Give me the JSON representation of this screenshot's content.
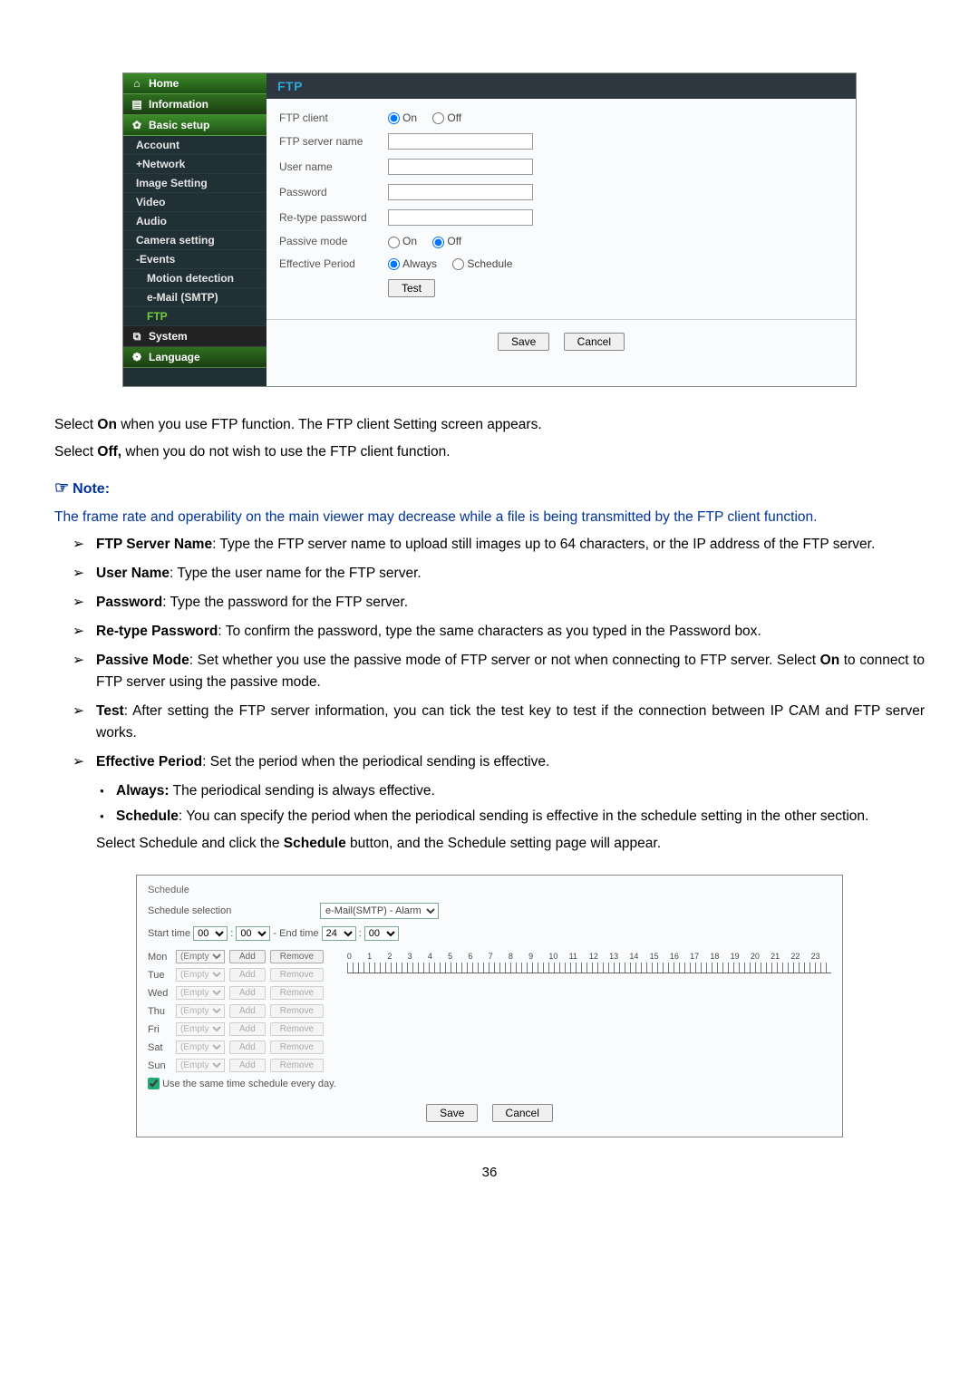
{
  "sidebar": {
    "home": "Home",
    "information": "Information",
    "basic_setup": "Basic setup",
    "account": "Account",
    "network": "+Network",
    "image_setting": "Image Setting",
    "video": "Video",
    "audio": "Audio",
    "camera_setting": "Camera setting",
    "events": "-Events",
    "motion_detection": "Motion detection",
    "email_smtp": "e-Mail (SMTP)",
    "ftp": "FTP",
    "system": "System",
    "language": "Language"
  },
  "ftp": {
    "title": "FTP",
    "client_label": "FTP client",
    "on": "On",
    "off": "Off",
    "server_name": "FTP server name",
    "user_name": "User name",
    "password": "Password",
    "retype_password": "Re-type password",
    "passive_mode": "Passive mode",
    "effective_period": "Effective Period",
    "always": "Always",
    "schedule": "Schedule",
    "test": "Test",
    "save": "Save",
    "cancel": "Cancel"
  },
  "doc": {
    "p1a": "Select ",
    "p1b": "On",
    "p1c": " when you use FTP function. The FTP client Setting screen appears.",
    "p2a": "Select ",
    "p2b": "Off,",
    "p2c": " when you do not wish to use the FTP client function.",
    "note_label": "Note",
    "note_body": "The frame rate and operability on the main viewer may decrease while a file is being transmitted by the FTP client function.",
    "li1b": "FTP Server Name",
    "li1t": ": Type the FTP server name to upload still images up to 64 characters, or the IP address of the FTP server.",
    "li2b": "User Name",
    "li2t": ": Type the user name for the FTP server.",
    "li3b": "Password",
    "li3t": ": Type the password for the FTP server.",
    "li4b": "Re-type Password",
    "li4t": ": To confirm the password, type the same characters as you typed in the Password box.",
    "li5b": "Passive Mode",
    "li5t1": ": Set whether you use the passive mode of FTP server or not when connecting to FTP server. Select ",
    "li5t2": "On",
    "li5t3": " to connect to FTP server using the passive mode.",
    "li6b": "Test",
    "li6t": ": After setting the FTP server information, you can tick the test key to test if the connection between IP CAM and FTP server works.",
    "li7b": "Effective Period",
    "li7t": ": Set the period when the periodical sending is effective.",
    "d1b": "Always:",
    "d1t": " The periodical sending is always effective.",
    "d2b": "Schedule",
    "d2t": ": You can specify the period when the periodical sending is effective in the schedule setting in the other section.",
    "p3a": "Select Schedule and click the ",
    "p3b": "Schedule",
    "p3c": " button, and the Schedule setting page will appear."
  },
  "sched": {
    "legend": "Schedule",
    "selection_label": "Schedule selection",
    "selection_value": "e-Mail(SMTP) - Alarm",
    "start_time": "Start time",
    "end_time": "End time",
    "st_h": "00",
    "st_m": "00",
    "et_h": "24",
    "et_m": "00",
    "sep": " : ",
    "dash": " - ",
    "days": [
      "Mon",
      "Tue",
      "Wed",
      "Thu",
      "Fri",
      "Sat",
      "Sun"
    ],
    "empty": "(Empty)",
    "add": "Add",
    "remove": "Remove",
    "hours": [
      "0",
      "1",
      "2",
      "3",
      "4",
      "5",
      "6",
      "7",
      "8",
      "9",
      "10",
      "11",
      "12",
      "13",
      "14",
      "15",
      "16",
      "17",
      "18",
      "19",
      "20",
      "21",
      "22",
      "23"
    ],
    "same_day": "Use the same time schedule every day.",
    "save": "Save",
    "cancel": "Cancel"
  },
  "page_number": "36"
}
